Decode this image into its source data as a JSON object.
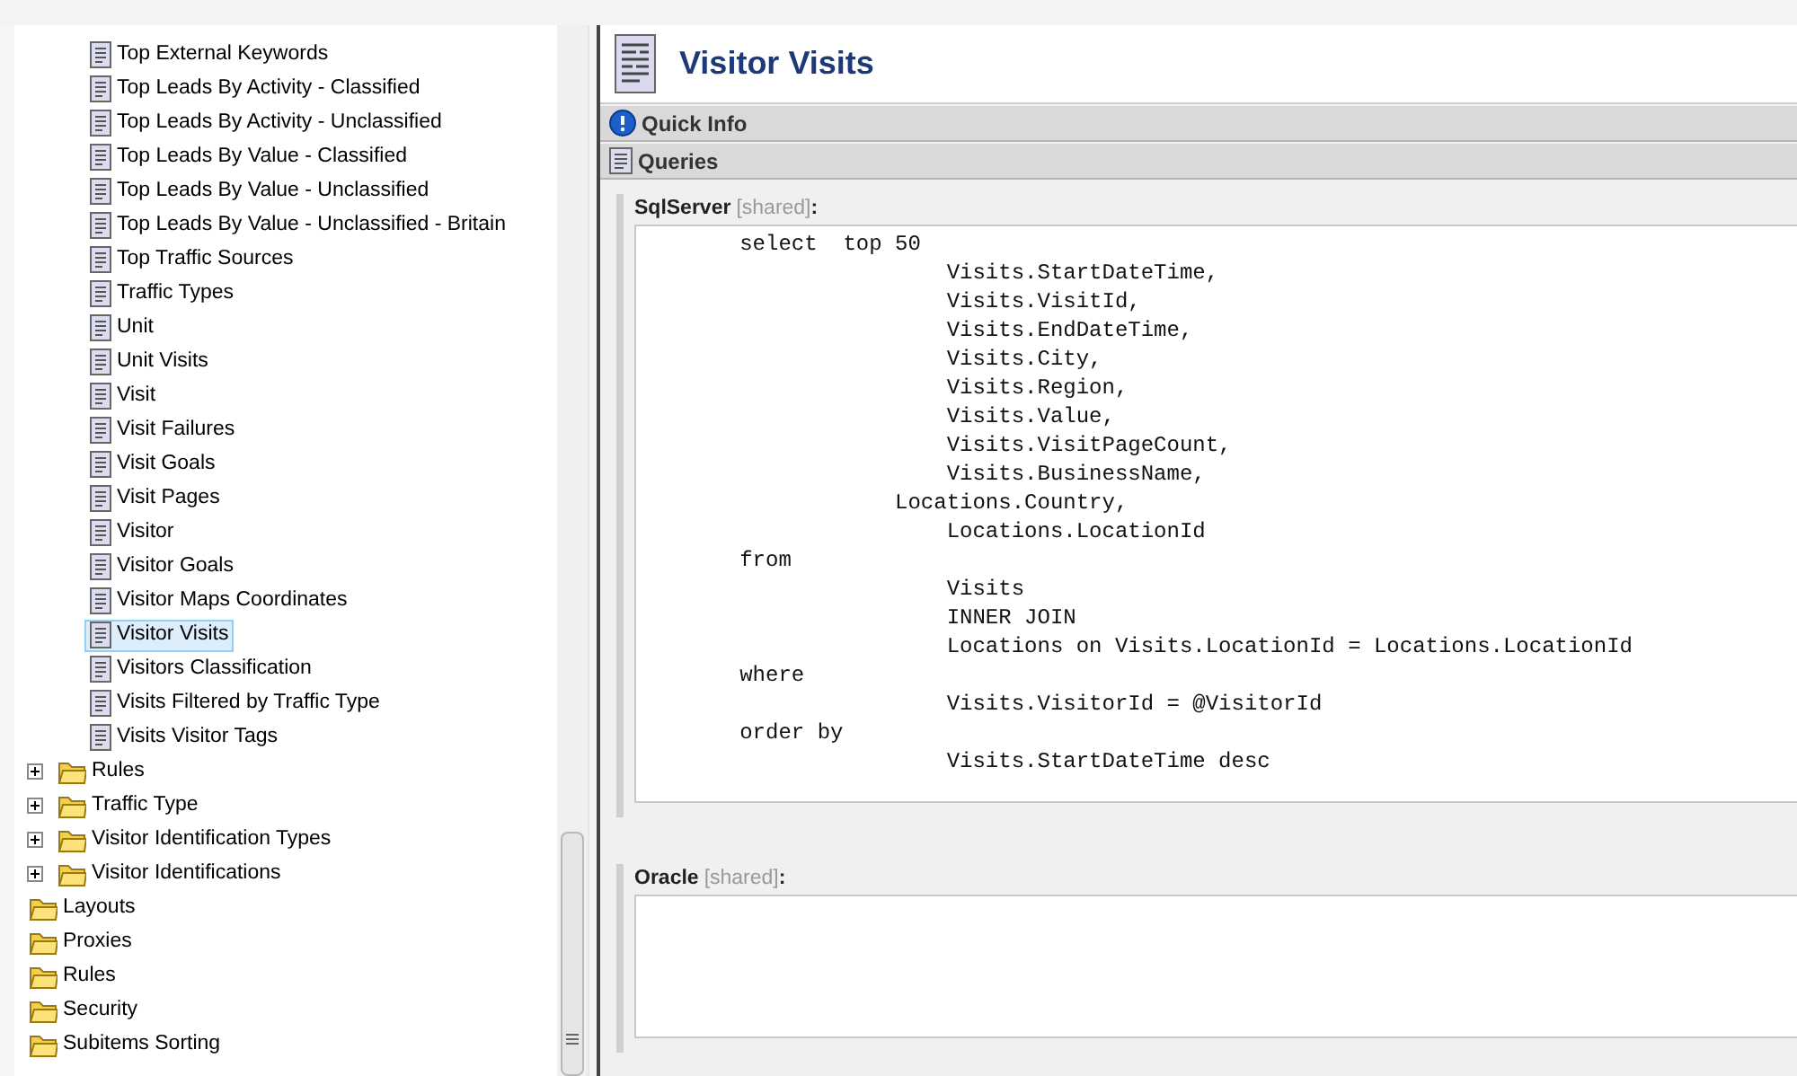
{
  "tree": [
    {
      "children": [
        {
          "children": [
            {
              "kind": "document",
              "label": "Top External Keywords",
              "selected": false
            },
            {
              "kind": "document",
              "label": "Top Leads By Activity - Classified",
              "selected": false
            },
            {
              "kind": "document",
              "label": "Top Leads By Activity - Unclassified",
              "selected": false
            },
            {
              "kind": "document",
              "label": "Top Leads By Value - Classified",
              "selected": false
            },
            {
              "kind": "document",
              "label": "Top Leads By Value - Unclassified",
              "selected": false
            },
            {
              "kind": "document",
              "label": "Top Leads By Value - Unclassified - Britain",
              "selected": false
            },
            {
              "kind": "document",
              "label": "Top Traffic Sources",
              "selected": false
            },
            {
              "kind": "document",
              "label": "Traffic Types",
              "selected": false
            },
            {
              "kind": "document",
              "label": "Unit",
              "selected": false
            },
            {
              "kind": "document",
              "label": "Unit Visits",
              "selected": false
            },
            {
              "kind": "document",
              "label": "Visit",
              "selected": false
            },
            {
              "kind": "document",
              "label": "Visit Failures",
              "selected": false
            },
            {
              "kind": "document",
              "label": "Visit Goals",
              "selected": false
            },
            {
              "kind": "document",
              "label": "Visit Pages",
              "selected": false
            },
            {
              "kind": "document",
              "label": "Visitor",
              "selected": false
            },
            {
              "kind": "document",
              "label": "Visitor Goals",
              "selected": false
            },
            {
              "kind": "document",
              "label": "Visitor Maps Coordinates",
              "selected": false
            },
            {
              "kind": "document",
              "label": "Visitor Visits",
              "selected": true
            },
            {
              "kind": "document",
              "label": "Visitors Classification",
              "selected": false
            },
            {
              "kind": "document",
              "label": "Visits Filtered by Traffic Type",
              "selected": false
            },
            {
              "kind": "document",
              "label": "Visits Visitor Tags",
              "selected": false
            }
          ]
        },
        {
          "kind": "folder",
          "label": "Rules",
          "expanded": false,
          "selected": false
        },
        {
          "kind": "folder",
          "label": "Traffic Type",
          "expanded": false,
          "selected": false
        },
        {
          "kind": "folder",
          "label": "Visitor Identification Types",
          "expanded": false,
          "selected": false
        },
        {
          "kind": "folder",
          "label": "Visitor Identifications",
          "expanded": false,
          "selected": false
        }
      ]
    },
    {
      "kind": "folder",
      "label": "Layouts",
      "selected": false
    },
    {
      "kind": "folder",
      "label": "Proxies",
      "selected": false
    },
    {
      "kind": "folder",
      "label": "Rules",
      "selected": false
    },
    {
      "kind": "folder",
      "label": "Security",
      "selected": false
    },
    {
      "kind": "folder",
      "label": "Subitems Sorting",
      "selected": false
    }
  ],
  "editor": {
    "title": "Visitor Visits",
    "sections": [
      {
        "kind": "info",
        "label": "Quick Info"
      },
      {
        "kind": "queries",
        "label": "Queries"
      }
    ],
    "fields": [
      {
        "name": "SqlServer",
        "tag": "[shared]",
        "suffix": ":",
        "value": "        select  top 50\n                        Visits.StartDateTime,\n                        Visits.VisitId,\n                        Visits.EndDateTime,\n                        Visits.City,\n                        Visits.Region,\n                        Visits.Value,\n                        Visits.VisitPageCount,\n                        Visits.BusinessName,\n                    Locations.Country,\n                        Locations.LocationId\n        from\n                        Visits\n                        INNER JOIN\n                        Locations on Visits.LocationId = Locations.LocationId\n        where\n                        Visits.VisitorId = @VisitorId\n        order by\n                        Visits.StartDateTime desc"
      },
      {
        "name": "Oracle",
        "tag": "[shared]",
        "suffix": ":"
      }
    ]
  }
}
